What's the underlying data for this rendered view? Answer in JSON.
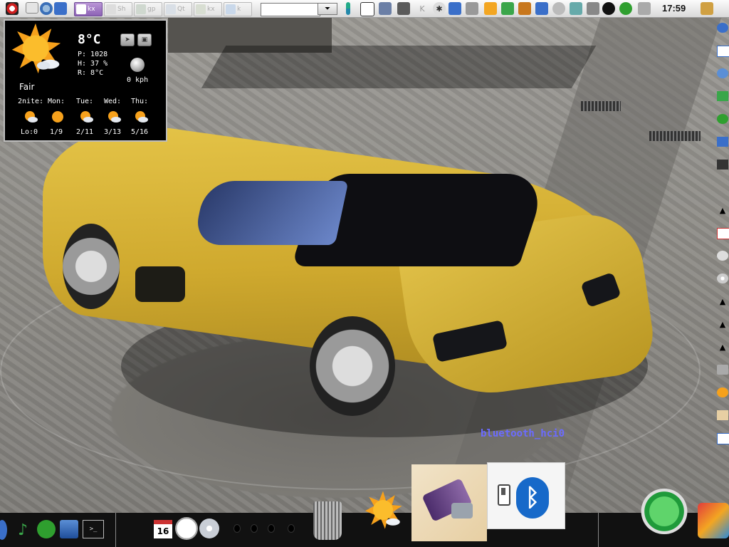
{
  "top_panel": {
    "taskbar": [
      {
        "label": "",
        "color": "#e8e8e8"
      },
      {
        "label": "",
        "color": "#5d8fd6"
      },
      {
        "label": "",
        "color": "#f2f2f2"
      },
      {
        "label": "kx",
        "active": true
      },
      {
        "label": "Sh"
      },
      {
        "label": "gp"
      },
      {
        "label": "Qt"
      },
      {
        "label": "kx"
      },
      {
        "label": "k"
      }
    ],
    "search_placeholder": "",
    "search_button": "⏷",
    "clock": "17:59"
  },
  "weather": {
    "temperature": "8°C",
    "pressure": "P: 1028",
    "humidity": "H: 37 %",
    "real_feel": "R: 8°C",
    "wind": "0 kph",
    "condition": "Fair",
    "forecast": [
      {
        "day": "2nite:",
        "value": "Lo:0"
      },
      {
        "day": "Mon:",
        "value": "1/9"
      },
      {
        "day": "Tue:",
        "value": "2/11"
      },
      {
        "day": "Wed:",
        "value": "3/13"
      },
      {
        "day": "Thu:",
        "value": "5/16"
      }
    ]
  },
  "desktop": {
    "bluetooth_label": "bluetooth_hci0"
  },
  "bottom_dock": {
    "calendar_day": "16",
    "terminal_prompt": ">_"
  },
  "colors": {
    "accent": "#8d63b5",
    "bluetooth": "#1769c9",
    "bt_label": "#6b6bff"
  }
}
